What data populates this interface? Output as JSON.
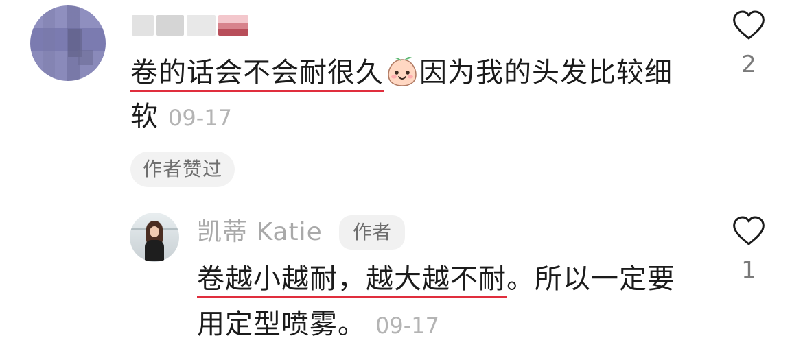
{
  "comment": {
    "username_blurred": true,
    "text_underlined": "卷的话会不会耐很久",
    "emoji": "smiling-peach-emoji",
    "text_rest": "因为我的头发比较细软",
    "time": "09-17",
    "author_liked_badge": "作者赞过",
    "like_count": "2"
  },
  "reply": {
    "username": "凯蒂 Katie",
    "author_tag": "作者",
    "text_underlined": "卷越小越耐，越大越不耐",
    "text_rest": "。所以一定要用定型喷雾。",
    "time": "09-17",
    "like_count": "1"
  },
  "colors": {
    "underline": "#e02e3d",
    "muted_text": "#a9a9a9",
    "badge_bg": "#f2f2f2"
  },
  "icons": [
    "heart-outline-icon",
    "smiling-peach-emoji"
  ]
}
